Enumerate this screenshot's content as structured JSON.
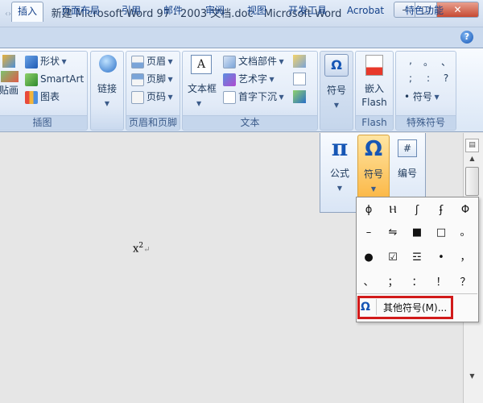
{
  "window": {
    "title": "新建 Microsoft Word 97 - 2003 文档.doc - Microsoft Word",
    "title_edge": "‹›",
    "minimize": "–",
    "maximize": "□",
    "close": "✕"
  },
  "tabs": [
    {
      "label": "插入",
      "active": true
    },
    {
      "label": "页面布局"
    },
    {
      "label": "引用"
    },
    {
      "label": "邮件"
    },
    {
      "label": "审阅"
    },
    {
      "label": "视图"
    },
    {
      "label": "开发工具"
    },
    {
      "label": "Acrobat"
    },
    {
      "label": "特色功能"
    }
  ],
  "help": "?",
  "ribbon": {
    "illustrations": {
      "paste_label": "贴画",
      "shapes": "形状",
      "smartart": "SmartArt",
      "chart": "图表",
      "group_label": "插图"
    },
    "links": {
      "label": "链接"
    },
    "header_footer": {
      "header": "页眉",
      "footer": "页脚",
      "page_number": "页码",
      "group_label": "页眉和页脚"
    },
    "text": {
      "textbox": "文本框",
      "quick_parts": "文档部件",
      "wordart": "艺术字",
      "dropcap": "首字下沉",
      "group_label": "文本"
    },
    "symbols": {
      "label": "符号"
    },
    "flash": {
      "label_line1": "嵌入",
      "label_line2": "Flash",
      "group_label": "Flash"
    },
    "special": {
      "chars": [
        ",",
        "。",
        "、",
        ";",
        ":",
        "?"
      ],
      "symbol_label": "符号",
      "bullet": "•",
      "group_label": "特殊符号"
    }
  },
  "subpanel": {
    "equation": "公式",
    "symbol": "符号",
    "numbering": "编号",
    "pi": "π",
    "omega": "Ω",
    "hash": "#"
  },
  "document": {
    "base": "x",
    "exponent": "2",
    "para_mark": "↵"
  },
  "symbol_dropdown": {
    "symbols": [
      "ɸ",
      "Ⲏ",
      "ʃ",
      "ʄ",
      "Φ",
      "–",
      "⇋",
      "■",
      "□",
      "。",
      "●",
      "☑",
      "☲",
      "•",
      "，",
      "、",
      "；",
      "：",
      "！",
      "？"
    ],
    "more_symbols": "其他符号(M)...",
    "more_icon": "Ω"
  }
}
